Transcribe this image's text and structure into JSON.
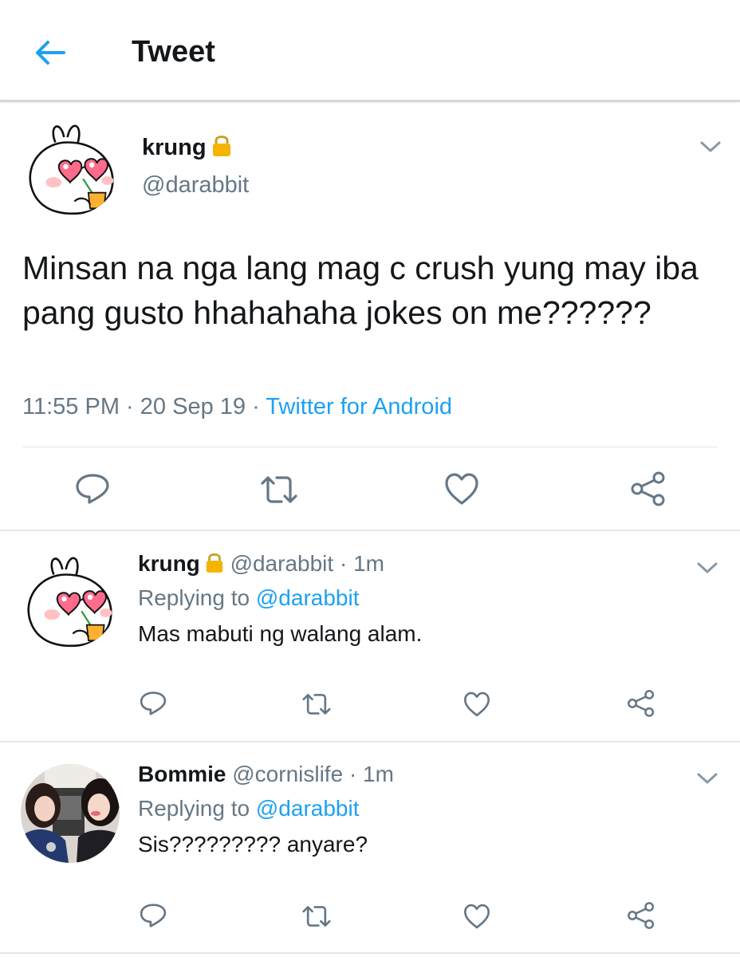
{
  "header": {
    "title": "Tweet",
    "back_icon": "arrow-left-icon"
  },
  "colors": {
    "accent": "#1da1f2",
    "secondary_text": "#657786",
    "primary_text": "#14171a",
    "divider": "#e1e8ed",
    "lock": "#f5b400"
  },
  "main_tweet": {
    "name": "krung",
    "handle": "@darabbit",
    "text": "Minsan na nga lang mag c crush yung may iba pang gusto hhahahaha jokes on me??????",
    "time": "11:55 PM",
    "date": "20 Sep 19",
    "source": "Twitter for Android",
    "actions": [
      "reply-icon",
      "retweet-icon",
      "like-icon",
      "share-icon"
    ]
  },
  "replies": [
    {
      "name": "krung",
      "handle": "@darabbit",
      "time": "1m",
      "replying_label": "Replying to",
      "replying_to": "@darabbit",
      "text": "Mas mabuti ng walang alam."
    },
    {
      "name": "Bommie",
      "handle": "@cornislife",
      "time": "1m",
      "replying_label": "Replying to",
      "replying_to": "@darabbit",
      "text": "Sis????????? anyare?"
    }
  ],
  "separator": "·"
}
